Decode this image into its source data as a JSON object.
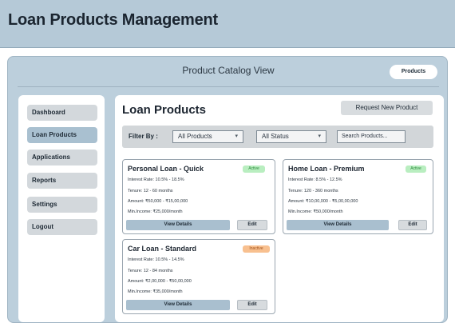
{
  "app": {
    "title": "Loan Products Management"
  },
  "header": {
    "view_title": "Product Catalog View",
    "products_pill": "Products"
  },
  "sidebar": {
    "items": [
      {
        "label": "Dashboard"
      },
      {
        "label": "Loan Products",
        "active": true
      },
      {
        "label": "Applications"
      },
      {
        "label": "Reports"
      },
      {
        "label": "Settings"
      },
      {
        "label": "Logout"
      }
    ]
  },
  "main": {
    "title": "Loan Products",
    "request_button": "Request New Product",
    "filter": {
      "label": "Filter By :",
      "products_select": "All Products",
      "status_select": "All Status",
      "search_placeholder": "Search Products..."
    },
    "cards": [
      {
        "name": "Personal Loan - Quick",
        "status": "Active",
        "interest": "Interest Rate: 10.5% - 18.5%",
        "tenure": "Tenure: 12 - 60 months",
        "amount": "Amount: ₹50,000 - ₹15,00,000",
        "income": "Min.Income: ₹25,000/month",
        "view_label": "View Details",
        "edit_label": "Edit"
      },
      {
        "name": "Home Loan - Premium",
        "status": "Active",
        "interest": "Interest Rate: 8.5% - 12.5%",
        "tenure": "Tenure: 120 - 360 months",
        "amount": "Amount: ₹10,00,000 - ₹5,00,00,000",
        "income": "Min.Income: ₹50,000/month",
        "view_label": "View Details",
        "edit_label": "Edit"
      },
      {
        "name": "Car Loan - Standard",
        "status": "Inactive",
        "interest": "Interest Rate: 10.5% - 14.5%",
        "tenure": "Tenure: 12 - 84 months",
        "amount": "Amount: ₹2,00,000 - ₹50,00,000",
        "income": "Min.Income: ₹35,000/month",
        "view_label": "View Details",
        "edit_label": "Edit"
      }
    ]
  },
  "colors": {
    "header_bg": "#b5c9d7",
    "panel_bg": "#bccfdc",
    "active_nav": "#a9c0d0",
    "badge_active": "#b9eec0",
    "badge_inactive": "#f8c08f"
  }
}
